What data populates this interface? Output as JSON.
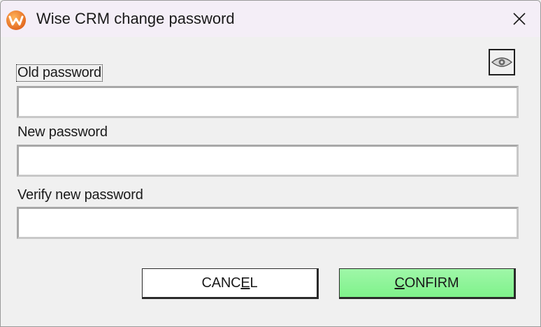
{
  "window": {
    "title": "Wise CRM change password",
    "close_icon": "close-icon",
    "app_icon": "wise-crm-logo-icon"
  },
  "toggle": {
    "icon": "eye-icon"
  },
  "fields": {
    "old_password": {
      "label": "Old password",
      "value": ""
    },
    "new_password": {
      "label": "New password",
      "value": ""
    },
    "verify_password": {
      "label": "Verify new password",
      "value": ""
    }
  },
  "buttons": {
    "cancel": {
      "pre": "CANC",
      "mnemonic": "E",
      "post": "L"
    },
    "confirm": {
      "pre": "",
      "mnemonic": "C",
      "post": "ONFIRM"
    }
  },
  "colors": {
    "titlebar": "#f4eef7",
    "confirm": "#8ef597",
    "logo": "#f07a20"
  }
}
